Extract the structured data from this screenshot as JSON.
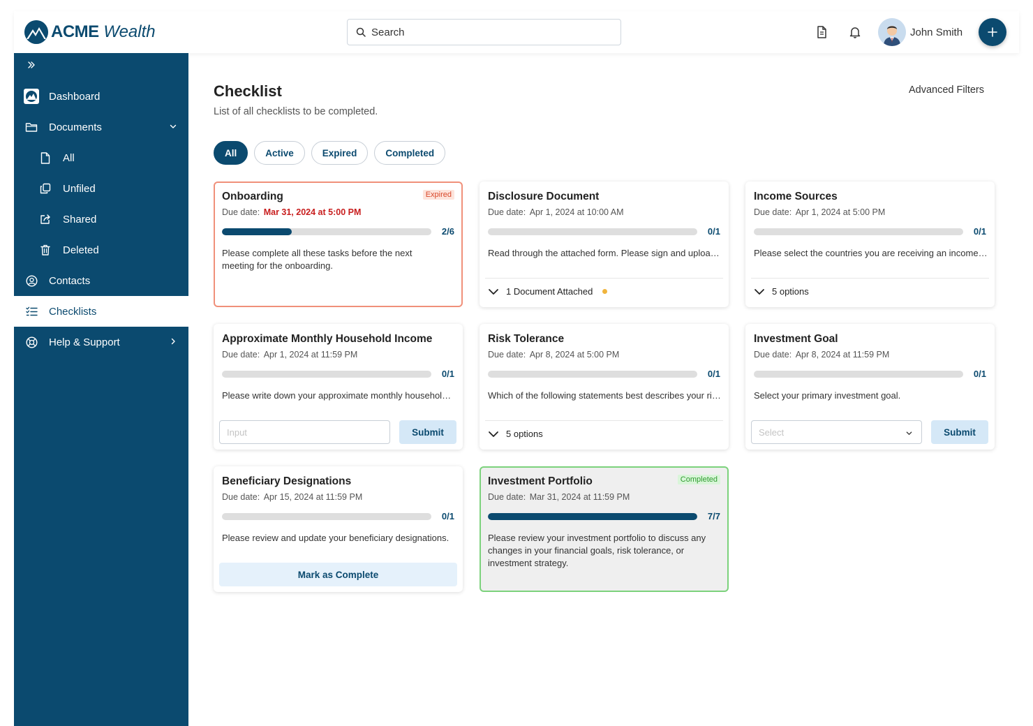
{
  "header": {
    "logo_bold": "ACME",
    "logo_italic": "Wealth",
    "search_placeholder": "Search",
    "user_name": "John Smith"
  },
  "sidebar": {
    "items": [
      {
        "label": "Dashboard",
        "icon": "dashboard-logo-icon"
      },
      {
        "label": "Documents",
        "icon": "folder-icon"
      },
      {
        "label": "All",
        "icon": "file-icon"
      },
      {
        "label": "Unfiled",
        "icon": "copy-icon"
      },
      {
        "label": "Shared",
        "icon": "share-icon"
      },
      {
        "label": "Deleted",
        "icon": "trash-icon"
      },
      {
        "label": "Contacts",
        "icon": "user-circle-icon"
      },
      {
        "label": "Checklists",
        "icon": "list-check-icon"
      },
      {
        "label": "Help & Support",
        "icon": "lifebuoy-icon"
      }
    ]
  },
  "main": {
    "title": "Checklist",
    "subtitle": "List of all checklists to be completed.",
    "advanced_filters": "Advanced Filters",
    "tabs": [
      "All",
      "Active",
      "Expired",
      "Completed"
    ],
    "active_tab": "All"
  },
  "cards": [
    {
      "title": "Onboarding",
      "due_label": "Due date:",
      "due": "Mar 31, 2024 at 5:00 PM",
      "progress": "2/6",
      "done": 2,
      "total": 6,
      "badge": "Expired",
      "desc": "Please complete all these tasks before the next meeting for the onboarding."
    },
    {
      "title": "Disclosure Document",
      "due_label": "Due date:",
      "due": "Apr 1, 2024 at 10:00 AM",
      "progress": "0/1",
      "done": 0,
      "total": 1,
      "desc": "Read through the attached form. Please sign and upload it back.",
      "expander": "1 Document Attached"
    },
    {
      "title": "Income Sources",
      "due_label": "Due date:",
      "due": "Apr 1, 2024 at 5:00 PM",
      "progress": "0/1",
      "done": 0,
      "total": 1,
      "desc": "Please select the countries you are receiving an income from.",
      "expander": "5 options"
    },
    {
      "title": "Approximate Monthly Household Income",
      "due_label": "Due date:",
      "due": "Apr 1, 2024 at 11:59 PM",
      "progress": "0/1",
      "done": 0,
      "total": 1,
      "desc": "Please write down your approximate monthly household income.",
      "input_placeholder": "Input",
      "button": "Submit"
    },
    {
      "title": "Risk Tolerance",
      "due_label": "Due date:",
      "due": "Apr 8, 2024 at 5:00 PM",
      "progress": "0/1",
      "done": 0,
      "total": 1,
      "desc": "Which of the following statements best describes your risk tolerance?",
      "expander": "5 options"
    },
    {
      "title": "Investment Goal",
      "due_label": "Due date:",
      "due": "Apr 8, 2024 at 11:59 PM",
      "progress": "0/1",
      "done": 0,
      "total": 1,
      "desc": "Select your primary investment goal.",
      "select_placeholder": "Select",
      "button": "Submit"
    },
    {
      "title": "Beneficiary Designations",
      "due_label": "Due date:",
      "due": "Apr 15, 2024 at 11:59 PM",
      "progress": "0/1",
      "done": 0,
      "total": 1,
      "desc": "Please review and update your beneficiary designations.",
      "button": "Mark as Complete"
    },
    {
      "title": "Investment Portfolio",
      "due_label": "Due date:",
      "due": "Mar 31, 2024 at 11:59 PM",
      "progress": "7/7",
      "done": 7,
      "total": 7,
      "badge": "Completed",
      "desc": "Please review your investment portfolio to discuss any changes in your financial goals, risk tolerance, or investment strategy."
    }
  ],
  "colors": {
    "brand": "#0b4a6f",
    "expired_border": "#f0907a",
    "completed_border": "#7cd27c",
    "expired_text": "#c81e1e",
    "attachment_dot": "#f0b43c"
  }
}
